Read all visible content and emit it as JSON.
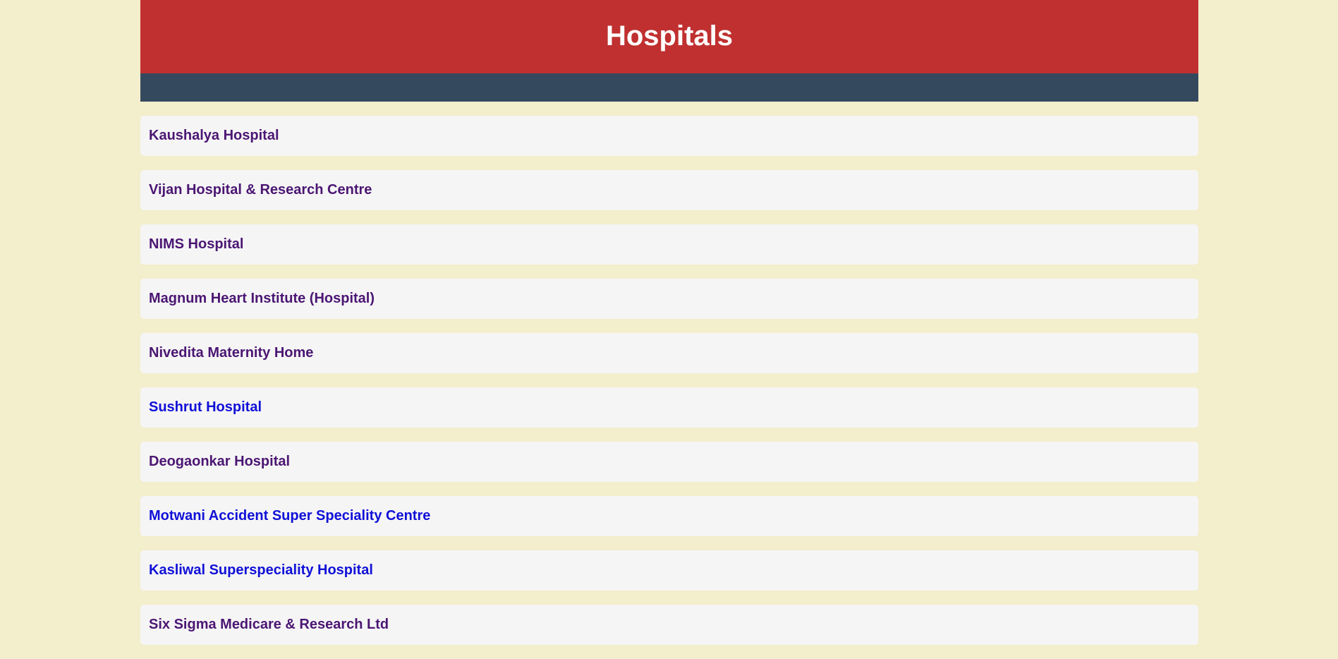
{
  "header": {
    "title": "Hospitals"
  },
  "colors": {
    "page_background": "#f3eecb",
    "header_background": "#c03030",
    "nav_background": "#34495e",
    "card_background": "#f5f5f5",
    "visited_link": "#4b1673",
    "unvisited_link": "#1010d8"
  },
  "hospitals": [
    {
      "name": "Kaushalya Hospital",
      "visited": true
    },
    {
      "name": "Vijan Hospital & Research Centre",
      "visited": true
    },
    {
      "name": "NIMS Hospital",
      "visited": true
    },
    {
      "name": "Magnum Heart Institute (Hospital)",
      "visited": true
    },
    {
      "name": "Nivedita Maternity Home",
      "visited": true
    },
    {
      "name": "Sushrut Hospital",
      "visited": false
    },
    {
      "name": "Deogaonkar Hospital",
      "visited": true
    },
    {
      "name": "Motwani Accident Super Speciality Centre",
      "visited": false
    },
    {
      "name": "Kasliwal Superspeciality Hospital",
      "visited": false
    },
    {
      "name": "Six Sigma Medicare & Research Ltd",
      "visited": true
    }
  ]
}
